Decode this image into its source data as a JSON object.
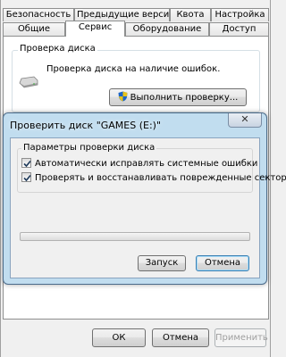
{
  "properties": {
    "tabs_row1": [
      {
        "label": "Безопасность"
      },
      {
        "label": "Предыдущие версии"
      },
      {
        "label": "Квота"
      },
      {
        "label": "Настройка"
      }
    ],
    "tabs_row2": [
      {
        "label": "Общие"
      },
      {
        "label": "Сервис"
      },
      {
        "label": "Оборудование"
      },
      {
        "label": "Доступ"
      }
    ],
    "check_group_title": "Проверка диска",
    "check_description": "Проверка диска на наличие ошибок.",
    "check_button": "Выполнить проверку...",
    "buttons": {
      "ok": "ОК",
      "cancel": "Отмена",
      "apply": "Применить"
    }
  },
  "dialog": {
    "title": "Проверить диск \"GAMES (E:)\"",
    "close_glyph": "✕",
    "options_title": "Параметры проверки диска",
    "options": [
      {
        "label": "Автоматически исправлять системные ошибки",
        "checked": true
      },
      {
        "label": "Проверять и восстанавливать поврежденные сектора",
        "checked": true
      }
    ],
    "progress_value": 0,
    "start_button": "Запуск",
    "cancel_button": "Отмена"
  },
  "icons": {
    "disk": "hard-disk-icon",
    "shield": "uac-shield-icon",
    "check": "checkmark-icon"
  }
}
